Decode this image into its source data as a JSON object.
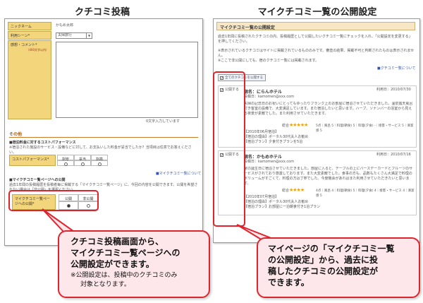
{
  "headings": {
    "left": "クチコミ投稿",
    "right": "マイクチコミ一覧の公開設定"
  },
  "left": {
    "nickname_label": "ニックネーム",
    "nickname_value": "かもめ太郎",
    "scene_label": "利用シーン*",
    "scene_value": "夫婦旅行",
    "comment_label": "感想・コメント*",
    "comment_note": "（400文字以内）",
    "char_counter": "0文字入力しています",
    "other_title": "その他",
    "cost_title": "■宿泊料金に対するコストパフォーマンス",
    "cost_note": "※宿泊された施設のサービス・設備などに対して、お支払いした料金が妥当でしたか？当項目は任意でお答えください。",
    "cost_label": "コストパフォーマンス*",
    "cost_options": [
      "割安",
      "妥当",
      "割高"
    ],
    "list_link": "■マイクチコミ一覧について",
    "public_title": "■マイクチコミ一覧ページへの公開",
    "public_note": "過去1年間の投稿履歴を投稿者毎に掲載する「マイクチコミ一覧ページ」に、今回の内容を公開できます。公開を希望されない場合は「非公開」を選択ください。",
    "public_label": "マイクチコミ一覧ページへの公開*",
    "public_options": [
      "公開",
      "非公開"
    ]
  },
  "right": {
    "title": "マイクチコミ一覧の公開設定",
    "intro": "過去1年間に投稿されたクチコミの内、投稿履歴として公開したいクチコミ一覧にチェックを入れ、「公開設定を変更する」を押してください。",
    "note1": "※表示されているクチコミはサイトに掲載されているもののみです。審査の結果、掲載不可と判断されたものは表示されません。",
    "note2": "※ここで非公開にしても、宿のクチコミ一覧には掲載されます。",
    "list_link": "■クチコミ一覧について",
    "all_public": "全てのクチコミを公開する",
    "reviews": [
      {
        "public_label": "公開する",
        "hotel": "宿名：にらんホテル",
        "date": "利用日：2010/07/30",
        "poster": "投稿日：kamomen@xxx.com",
        "body": "夫婦の記念日のお祝いにとってもゆったりフランク上のお部屋に宿泊させていただきました。温泉露天風呂付き客室の設備で、大変満足しています。また宿泊したいと思います。ハーブ、ソナンバーの浴室から見える夜景が素敵でした。また利用させていただきます。",
        "rating_label": "総合",
        "stars": "★★★★★",
        "scores": "5点｜風呂 5｜料理(朝食) 5｜料理(夕食) -｜接客・サービス 5｜清潔感 5",
        "meta1": "【2010年06月宿泊】",
        "meta2": "【宿泊の理由】ポータル30代夫人お勧め",
        "meta3": "【宿泊プラン】夕食付きプランを5泊"
      },
      {
        "public_label": "公開する",
        "hotel": "宿名：かもめホテル",
        "date": "利用日：2010/07/16",
        "poster": "投稿日：kamomen@xxx.com",
        "body": "家の誕生日に宿泊させていただきました。部屋に入ると、テーブルの上にバースデーカードとフルーツのサービスがされており感激しております。また大変素敵でした。食事の方も、品数もたくさん大満足で料理のボリュームがすごくて、料理の方は丁寧でした。今度機会があればまた利用させていただきたいと思います。",
        "rating_label": "総合",
        "stars": "★★★★",
        "scores": "4点｜風呂 4｜料理(朝食) 5｜料理(夕食) 4｜接客・サービス 4｜清潔感 5",
        "meta1": "【2010年07月宿泊】",
        "meta2": "【宿泊の理由】ポータル30代夫人お勧め",
        "meta3": "【宿泊プラン】お部屋に一泊朝食付き1泊プラン"
      }
    ]
  },
  "callouts": {
    "left": {
      "line1": "クチコミ投稿画面から、",
      "line2": "マイクチコミ一覧ページへの",
      "line3": "公開設定ができます。",
      "note1": "※公開設定は、投稿中のクチコミのみ",
      "note2": "対象となります。"
    },
    "right": {
      "line1": "マイページの「マイクチコミ一覧",
      "line2": "の公開設定」から、過去に投",
      "line3": "稿したクチコミの公開設定が",
      "line4": "できます。"
    }
  },
  "colors": {
    "accent_red": "#e0242e",
    "label_yellow": "#f3d57b",
    "callout_pink": "#fde7ea",
    "section_orange": "#b75a00"
  }
}
